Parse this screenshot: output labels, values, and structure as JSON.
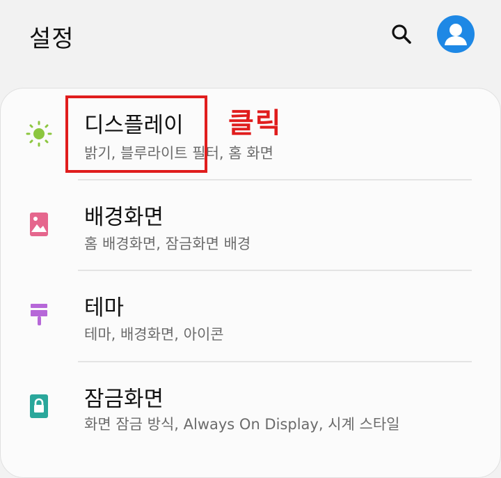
{
  "header": {
    "title": "설정",
    "search_icon": "search-icon",
    "avatar_icon": "account-avatar-icon"
  },
  "settings": {
    "items": [
      {
        "label": "디스플레이",
        "subtitle": "밝기, 블루라이트 필터, 홈 화면",
        "icon": "sun-icon",
        "icon_color": "#8cc63f"
      },
      {
        "label": "배경화면",
        "subtitle": "홈 배경화면, 잠금화면 배경",
        "icon": "image-icon",
        "icon_color": "#e5668d"
      },
      {
        "label": "테마",
        "subtitle": "테마, 배경화면, 아이콘",
        "icon": "paint-brush-icon",
        "icon_color": "#b667d8"
      },
      {
        "label": "잠금화면",
        "subtitle": "화면 잠금 방식, Always On Display, 시계 스타일",
        "icon": "lock-icon",
        "icon_color": "#2aa79b"
      }
    ]
  },
  "annotation": {
    "click_text": "클릭",
    "color": "#e01d1d"
  },
  "colors": {
    "accent_blue": "#1e88e5",
    "background": "#f2f2f2",
    "card": "#fbfbfb"
  }
}
